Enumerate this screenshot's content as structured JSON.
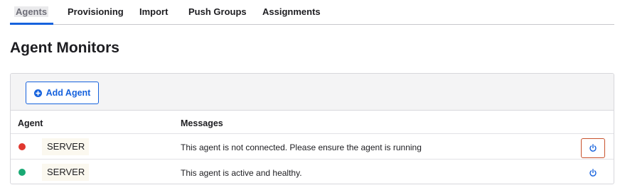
{
  "tabs": [
    {
      "label": "Agents",
      "active": true
    },
    {
      "label": "Provisioning"
    },
    {
      "label": "Import"
    },
    {
      "label": "Push Groups"
    },
    {
      "label": "Assignments"
    }
  ],
  "page_title": "Agent Monitors",
  "toolbar": {
    "add_agent_label": "Add Agent"
  },
  "table": {
    "headers": {
      "agent": "Agent",
      "messages": "Messages"
    },
    "rows": [
      {
        "status": "disconnected",
        "status_color": "#e0382f",
        "agent": "SERVER",
        "message": "This agent is not connected. Please ensure the agent is running",
        "action_icon": "power-icon"
      },
      {
        "status": "active",
        "status_color": "#19a974",
        "agent": "SERVER",
        "message": "This agent is active and healthy.",
        "action_icon": "power-icon"
      }
    ]
  },
  "colors": {
    "accent": "#1662dd",
    "danger_outline": "#c8522c"
  }
}
